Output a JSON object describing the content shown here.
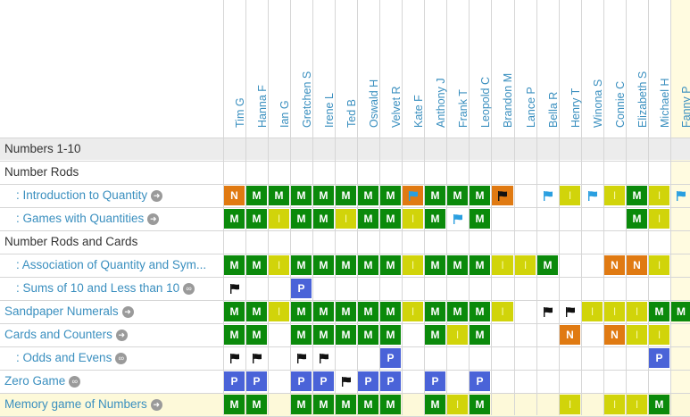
{
  "students": [
    "Tim G",
    "Hanna F",
    "Ian G",
    "Gretchen S",
    "Irene L",
    "Ted B",
    "Oswald H",
    "Velvet R",
    "Kate F",
    "Anthony J",
    "Frank T",
    "Leopold C",
    "Brandon M",
    "Lance P",
    "Bella R",
    "Henry T",
    "Winona S",
    "Connie C",
    "Elizabeth S",
    "Michael H",
    "Fanny P"
  ],
  "colors": {
    "M": "#0b8a0b",
    "N": "#e07a12",
    "P": "#4a63d8",
    "I": "#d1d40a",
    "flag_blue": "#2a9fe0",
    "flag_black": "#111111",
    "section_band": "#ececec",
    "highlight_col": "#fffbe0",
    "highlight_row": "#fdf9d9",
    "link": "#3a8fbf"
  },
  "legend_glyphs": {
    "I": "I"
  },
  "rows": [
    {
      "label": "Numbers 1-10",
      "kind": "band",
      "cells": []
    },
    {
      "label": "Number Rods",
      "kind": "section",
      "cells": []
    },
    {
      "label": ": Introduction to Quantity",
      "kind": "item",
      "icon": "arrow-right-icon",
      "icon_glyph": "➜",
      "indent": true,
      "cells": [
        "N",
        "M",
        "M",
        "M",
        "M",
        "M",
        "M",
        "M",
        "flag-blue-filled",
        "M",
        "M",
        "M",
        "flag-black-filled",
        "",
        "flag-blue",
        "I",
        "flag-blue",
        "I",
        "M",
        "I",
        "flag-blue"
      ]
    },
    {
      "label": ": Games with Quantities",
      "kind": "item",
      "icon": "arrow-right-icon",
      "icon_glyph": "➜",
      "indent": true,
      "cells": [
        "M",
        "M",
        "I",
        "M",
        "M",
        "I",
        "M",
        "M",
        "I",
        "M",
        "flag-blue",
        "M",
        "",
        "",
        "",
        "",
        "",
        "",
        "M",
        "I",
        ""
      ]
    },
    {
      "label": "Number Rods and Cards",
      "kind": "section",
      "cells": []
    },
    {
      "label": ": Association of Quantity and Sym...",
      "kind": "item",
      "icon": "",
      "icon_glyph": "",
      "indent": true,
      "cells": [
        "M",
        "M",
        "I",
        "M",
        "M",
        "M",
        "M",
        "M",
        "I",
        "M",
        "M",
        "M",
        "I",
        "I",
        "M",
        "",
        "",
        "N",
        "N",
        "I",
        ""
      ]
    },
    {
      "label": ": Sums of 10 and Less than 10",
      "kind": "item",
      "icon": "loop-icon",
      "icon_glyph": "∞",
      "indent": true,
      "cells": [
        "flag-black",
        "",
        "",
        "P",
        "",
        "",
        "",
        "",
        "",
        "",
        "",
        "",
        "",
        "",
        "",
        "",
        "",
        "",
        "",
        "",
        ""
      ]
    },
    {
      "label": "Sandpaper Numerals",
      "kind": "item",
      "icon": "arrow-right-icon",
      "icon_glyph": "➜",
      "indent": false,
      "cells": [
        "M",
        "M",
        "I",
        "M",
        "M",
        "M",
        "M",
        "M",
        "I",
        "M",
        "M",
        "M",
        "I",
        "",
        "flag-black",
        "flag-black",
        "I",
        "I",
        "I",
        "M",
        "M"
      ]
    },
    {
      "label": "Cards and Counters",
      "kind": "item",
      "icon": "arrow-right-icon",
      "icon_glyph": "➜",
      "indent": false,
      "cells": [
        "M",
        "M",
        "",
        "M",
        "M",
        "M",
        "M",
        "M",
        "",
        "M",
        "I",
        "M",
        "",
        "",
        "",
        "N",
        "",
        "N",
        "I",
        "I",
        ""
      ]
    },
    {
      "label": ": Odds and Evens",
      "kind": "item",
      "icon": "loop-icon",
      "icon_glyph": "∞",
      "indent": true,
      "cells": [
        "flag-black",
        "flag-black",
        "",
        "flag-black",
        "flag-black",
        "",
        "",
        "P",
        "",
        "",
        "",
        "",
        "",
        "",
        "",
        "",
        "",
        "",
        "",
        "P",
        ""
      ]
    },
    {
      "label": "Zero Game",
      "kind": "item",
      "icon": "loop-icon",
      "icon_glyph": "∞",
      "indent": false,
      "cells": [
        "P",
        "P",
        "",
        "P",
        "P",
        "flag-black",
        "P",
        "P",
        "",
        "P",
        "",
        "P",
        "",
        "",
        "",
        "",
        "",
        "",
        "",
        "",
        ""
      ]
    },
    {
      "label": "Memory game of Numbers",
      "kind": "item",
      "icon": "arrow-right-icon",
      "icon_glyph": "➜",
      "indent": false,
      "highlight": true,
      "cells": [
        "M",
        "M",
        "",
        "M",
        "M",
        "M",
        "M",
        "M",
        "",
        "M",
        "I",
        "M",
        "",
        "",
        "",
        "I",
        "",
        "I",
        "I",
        "M",
        ""
      ]
    }
  ]
}
